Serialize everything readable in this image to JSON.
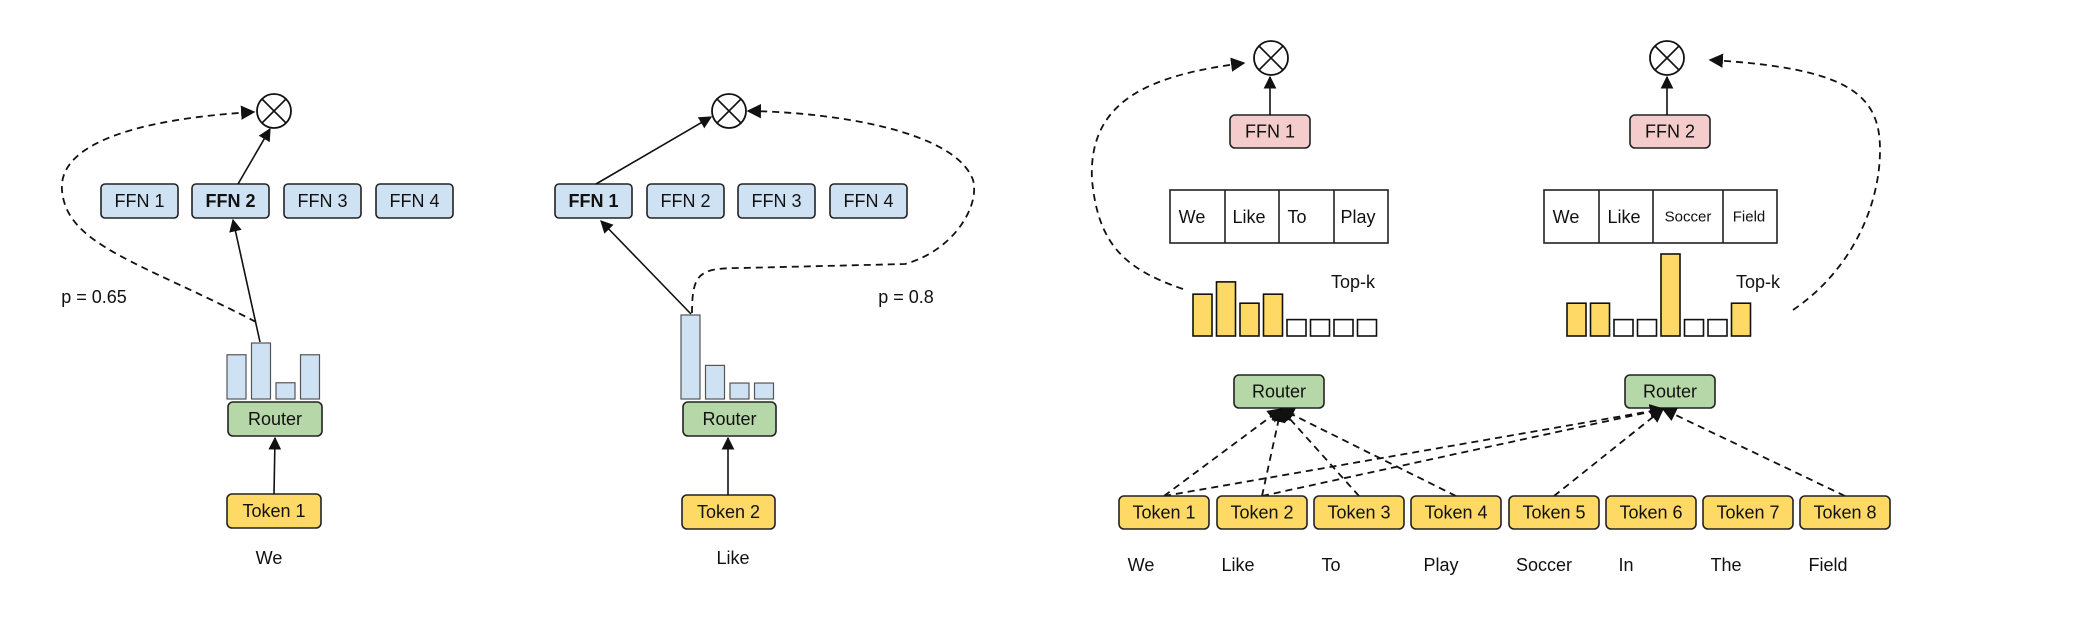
{
  "colors": {
    "expert_blue": "#cfe2f3",
    "router_green": "#b6d7a8",
    "token_yellow": "#ffd966",
    "expert_pink": "#f4cccc",
    "bar_empty": "#ffffff"
  },
  "icons": {
    "combine": "circle-times-icon"
  },
  "token_choice": [
    {
      "experts": [
        "FFN 1",
        "FFN 2",
        "FFN 3",
        "FFN 4"
      ],
      "selected_expert": "FFN 2",
      "router": "Router",
      "token": "Token 1",
      "word": "We",
      "probability_label": "p = 0.65",
      "router_scores": [
        0.79,
        1.0,
        0.29,
        0.79
      ]
    },
    {
      "experts": [
        "FFN 1",
        "FFN 2",
        "FFN 3",
        "FFN 4"
      ],
      "selected_expert": "FFN 1",
      "router": "Router",
      "token": "Token 2",
      "word": "Like",
      "probability_label": "p = 0.8",
      "router_scores": [
        1.0,
        0.4,
        0.19,
        0.19
      ]
    }
  ],
  "expert_choice": {
    "experts": [
      {
        "name": "FFN 1",
        "router": "Router",
        "topk_label": "Top-k",
        "selected_tokens": [
          "We",
          "Like",
          "To",
          "Play"
        ],
        "scores": [
          0.51,
          0.66,
          0.4,
          0.51,
          0.2,
          0.2,
          0.2,
          0.2
        ],
        "selected": [
          true,
          true,
          true,
          true,
          false,
          false,
          false,
          false
        ],
        "inputs": [
          1,
          2,
          3,
          4
        ]
      },
      {
        "name": "FFN 2",
        "router": "Router",
        "topk_label": "Top-k",
        "selected_tokens": [
          "We",
          "Like",
          "Soccer",
          "Field"
        ],
        "scores": [
          0.4,
          0.4,
          0.2,
          0.2,
          1.0,
          0.2,
          0.2,
          0.4
        ],
        "selected": [
          true,
          true,
          false,
          false,
          true,
          false,
          false,
          true
        ],
        "inputs": [
          1,
          2,
          5,
          8
        ]
      }
    ],
    "tokens": [
      "Token 1",
      "Token 2",
      "Token 3",
      "Token 4",
      "Token 5",
      "Token 6",
      "Token 7",
      "Token 8"
    ],
    "words": [
      "We",
      "Like",
      "To",
      "Play",
      "Soccer",
      "In",
      "The",
      "Field"
    ]
  }
}
